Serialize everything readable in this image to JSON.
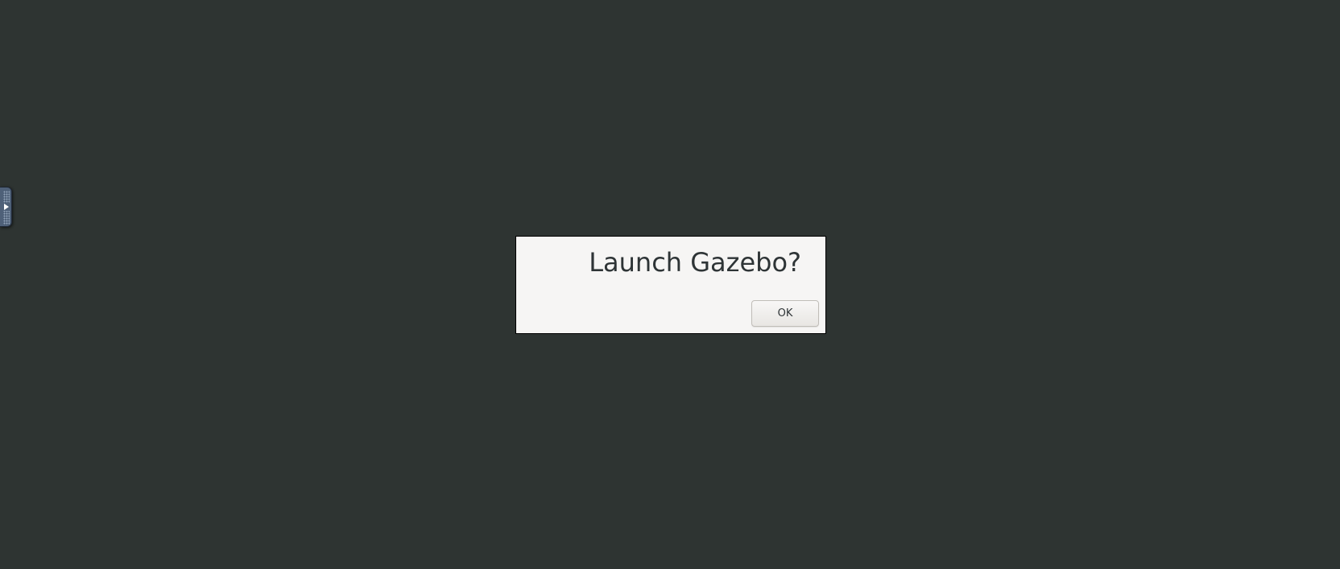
{
  "desktop": {
    "background_color": "#2e3432"
  },
  "side_panel": {
    "handle_icon": "expand-arrow-icon",
    "handle_color": "#4e6078"
  },
  "dialog": {
    "message": "Launch Gazebo?",
    "ok_label": "OK"
  }
}
